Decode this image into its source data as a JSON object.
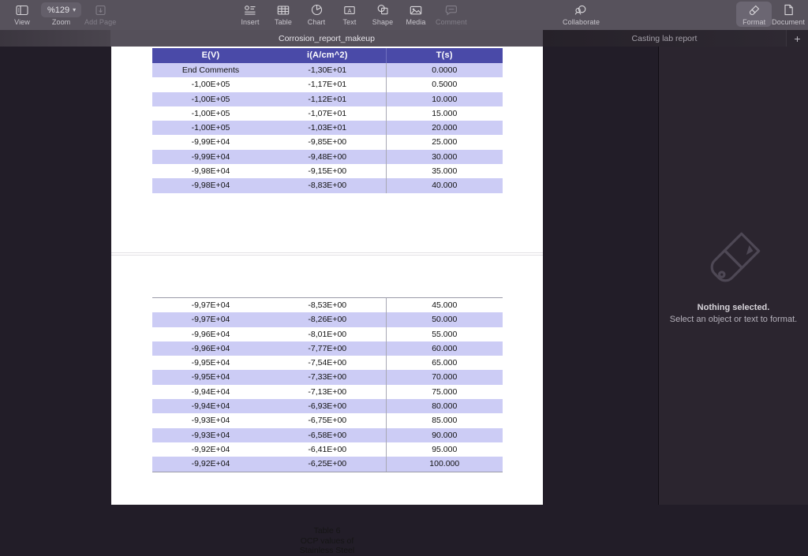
{
  "toolbar": {
    "left": [
      {
        "label": "View",
        "icon": "sidebar-icon",
        "dim": false
      },
      {
        "label": "Zoom",
        "icon": "zoom-value",
        "value": "%129",
        "dim": false
      },
      {
        "label": "Add Page",
        "icon": "add-page-icon",
        "dim": true
      }
    ],
    "center": [
      {
        "label": "Insert",
        "icon": "insert-icon",
        "dim": false
      },
      {
        "label": "Table",
        "icon": "table-icon",
        "dim": false
      },
      {
        "label": "Chart",
        "icon": "chart-icon",
        "dim": false
      },
      {
        "label": "Text",
        "icon": "text-icon",
        "dim": false
      },
      {
        "label": "Shape",
        "icon": "shape-icon",
        "dim": false
      },
      {
        "label": "Media",
        "icon": "media-icon",
        "dim": false
      },
      {
        "label": "Comment",
        "icon": "comment-icon",
        "dim": true
      }
    ],
    "collaborate": {
      "label": "Collaborate",
      "icon": "collaborate-icon"
    },
    "right": [
      {
        "label": "Format",
        "icon": "paintbrush-icon",
        "active": true
      },
      {
        "label": "Document",
        "icon": "document-icon",
        "active": false
      }
    ]
  },
  "tabs": {
    "active_label": "Corrosion_report_makeup",
    "other_label": "Casting lab report",
    "new_tab_label": "+"
  },
  "document": {
    "table": {
      "headers": [
        "E(V)",
        "i(A/cm^2)",
        "T(s)"
      ],
      "rows_page1": [
        [
          "End Comments",
          "-1,30E+01",
          "0.0000"
        ],
        [
          "-1,00E+05",
          "-1,17E+01",
          "0.5000"
        ],
        [
          "-1,00E+05",
          "-1,12E+01",
          "10.000"
        ],
        [
          "-1,00E+05",
          "-1,07E+01",
          "15.000"
        ],
        [
          "-1,00E+05",
          "-1,03E+01",
          "20.000"
        ],
        [
          "-9,99E+04",
          "-9,85E+00",
          "25.000"
        ],
        [
          "-9,99E+04",
          "-9,48E+00",
          "30.000"
        ],
        [
          "-9,98E+04",
          "-9,15E+00",
          "35.000"
        ],
        [
          "-9,98E+04",
          "-8,83E+00",
          "40.000"
        ]
      ],
      "rows_page2": [
        [
          "-9,97E+04",
          "-8,53E+00",
          "45.000"
        ],
        [
          "-9,97E+04",
          "-8,26E+00",
          "50.000"
        ],
        [
          "-9,96E+04",
          "-8,01E+00",
          "55.000"
        ],
        [
          "-9,96E+04",
          "-7,77E+00",
          "60.000"
        ],
        [
          "-9,95E+04",
          "-7,54E+00",
          "65.000"
        ],
        [
          "-9,95E+04",
          "-7,33E+00",
          "70.000"
        ],
        [
          "-9,94E+04",
          "-7,13E+00",
          "75.000"
        ],
        [
          "-9,94E+04",
          "-6,93E+00",
          "80.000"
        ],
        [
          "-9,93E+04",
          "-6,75E+00",
          "85.000"
        ],
        [
          "-9,93E+04",
          "-6,58E+00",
          "90.000"
        ],
        [
          "-9,92E+04",
          "-6,41E+00",
          "95.000"
        ],
        [
          "-9,92E+04",
          "-6,25E+00",
          "100.000"
        ]
      ]
    },
    "caption": {
      "line1": "Table 6",
      "line2": "OCP values of",
      "line3": "Stainless Steel"
    }
  },
  "format_panel": {
    "title": "Nothing selected.",
    "subtitle": "Select an object or text to format.",
    "icon": "paintbrush-icon"
  },
  "colors": {
    "table_header_bg": "#4a4aa8",
    "table_alt_row_bg": "#ccccf5",
    "toolbar_bg": "#57525c",
    "canvas_bg": "#221d28",
    "panel_bg": "#2b252f"
  }
}
